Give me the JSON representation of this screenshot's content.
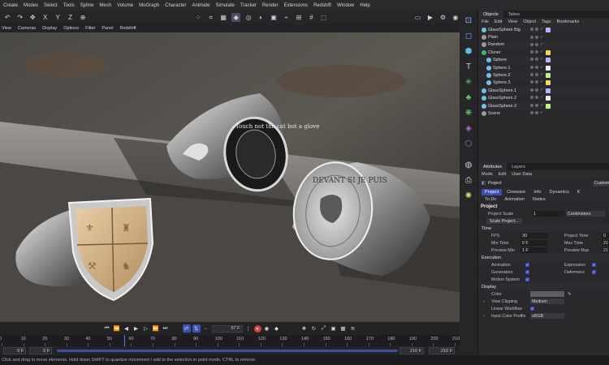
{
  "menu": [
    "Create",
    "Modes",
    "Select",
    "Tools",
    "Spline",
    "Mesh",
    "Volume",
    "MoGraph",
    "Character",
    "Animate",
    "Simulate",
    "Tracker",
    "Render",
    "Extensions",
    "Redshift",
    "Window",
    "Help"
  ],
  "toolbar": {
    "axis_x": "X",
    "axis_y": "Y",
    "axis_z": "Z"
  },
  "viewport_menu": [
    "View",
    "Cameras",
    "Display",
    "Options",
    "Filter",
    "Panel",
    "Redshift"
  ],
  "viewport_content": {
    "ring_engravings": [
      "Touch not the cat bot a glove",
      "DEVANT SI JE PUIS"
    ]
  },
  "objects_panel": {
    "tabs": [
      "Objects",
      "Takes"
    ],
    "menu": [
      "File",
      "Edit",
      "View",
      "Object",
      "Tags",
      "Bookmarks"
    ],
    "items": [
      {
        "name": "GlassSphere Big",
        "indent": 0,
        "color": "#6ec3e6"
      },
      {
        "name": "Plain",
        "indent": 0,
        "color": "#9a9aa0"
      },
      {
        "name": "Random",
        "indent": 0,
        "color": "#9a9aa0"
      },
      {
        "name": "Cloner",
        "indent": 0,
        "color": "#3fb56b"
      },
      {
        "name": "Sphere",
        "indent": 1,
        "color": "#6ec3e6"
      },
      {
        "name": "Sphere.1",
        "indent": 1,
        "color": "#6ec3e6"
      },
      {
        "name": "Sphere.2",
        "indent": 1,
        "color": "#6ec3e6"
      },
      {
        "name": "Sphere.3",
        "indent": 1,
        "color": "#6ec3e6"
      },
      {
        "name": "GlassSphere.1",
        "indent": 0,
        "color": "#6ec3e6"
      },
      {
        "name": "GlassSphere.2",
        "indent": 0,
        "color": "#6ec3e6"
      },
      {
        "name": "GlassSphere.3",
        "indent": 0,
        "color": "#6ec3e6"
      },
      {
        "name": "Scene",
        "indent": 0,
        "color": "#9a9aa0"
      }
    ]
  },
  "attributes_panel": {
    "tabs": [
      "Attributes",
      "Layers"
    ],
    "menu": [
      "Mode",
      "Edit",
      "User Data"
    ],
    "object_name": "Project",
    "custom_label": "Custom",
    "subtabs_row1": [
      "Project",
      "Cineware",
      "Info",
      "Dynamics",
      "K"
    ],
    "subtabs_row2": [
      "To Do",
      "Animation",
      "Nodes"
    ],
    "section": "Project",
    "project_scale_label": "Project Scale",
    "project_scale_value": "1",
    "project_scale_unit": "Centimeters",
    "scale_button": "Scale Project...",
    "time": {
      "title": "Time",
      "fps_label": "FPS",
      "fps": "30",
      "project_time_label": "Project Time",
      "project_time": "0",
      "min_time_label": "Min Time",
      "min_time": "0 F",
      "max_time_label": "Max Time",
      "max_time": "21",
      "preview_min_label": "Preview Min",
      "preview_min": "1 F",
      "preview_max_label": "Preview Max",
      "preview_max": "21"
    },
    "execution": {
      "title": "Execution",
      "animation": "Animation",
      "expression": "Expression",
      "generators": "Generators",
      "deformers": "Deformers",
      "motion_system": "Motion System"
    },
    "display": {
      "title": "Display",
      "color_label": "Color",
      "view_clipping_label": "View Clipping",
      "view_clipping": "Medium",
      "linear_workflow_label": "Linear Workflow",
      "input_color_profile_label": "Input Color Profile",
      "input_color_profile": "sRGB"
    }
  },
  "transport": {
    "current_frame": "57 F"
  },
  "ruler": {
    "ticks": [
      "0",
      "10",
      "20",
      "30",
      "40",
      "50",
      "60",
      "70",
      "80",
      "90",
      "100",
      "110",
      "120",
      "130",
      "140",
      "150",
      "160",
      "170",
      "180",
      "190",
      "200",
      "210"
    ]
  },
  "frames": {
    "start": "0 F",
    "start2": "0 F",
    "end": "210 F",
    "end2": "210 F"
  },
  "status": "Click and drag to move elements. Hold down SHIFT to quantize movement / add to the selection in point mode, CTRL to remove.",
  "colors": {
    "accent": "#3c4fae",
    "record": "#d34141"
  }
}
